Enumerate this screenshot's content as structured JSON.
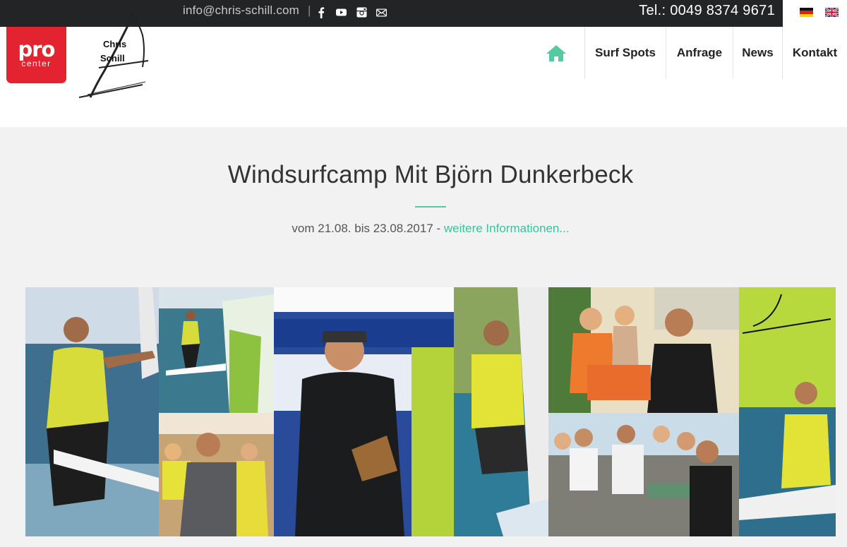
{
  "topbar": {
    "email": "info@chris-schill.com",
    "separator": "|",
    "social": [
      "facebook-icon",
      "youtube-icon",
      "instagram-icon",
      "mail-icon"
    ],
    "phone": "Tel.: 0049 8374 9671",
    "languages": [
      "de-flag-icon",
      "en-flag-icon"
    ]
  },
  "logo": {
    "pro": "pro",
    "center": "center",
    "chris": "Chris",
    "schill": "Schill"
  },
  "nav": {
    "home_icon": "home-icon",
    "items": [
      "Surf Spots",
      "Anfrage",
      "News",
      "Kontakt"
    ]
  },
  "hero": {
    "title": "Windsurfcamp Mit Björn Dunkerbeck",
    "date_text": "vom 21.08. bis 23.08.2017 - ",
    "link_text": "weitere Informationen..."
  },
  "colors": {
    "brand_red": "#e3232f",
    "accent_green": "#3cc19b",
    "topbar": "#222426",
    "page_bg": "#f2f2f2"
  }
}
